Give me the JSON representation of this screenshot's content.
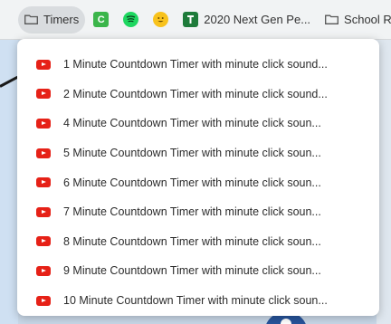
{
  "bookmarks_bar": {
    "items": [
      {
        "type": "folder",
        "label": "Timers",
        "active": true
      },
      {
        "type": "favicon",
        "icon": "classroom-c-icon",
        "label": "C"
      },
      {
        "type": "favicon",
        "icon": "spotify-icon",
        "label": ""
      },
      {
        "type": "favicon",
        "icon": "smiley-emoji-icon",
        "label": ""
      },
      {
        "type": "bookmark",
        "icon": "green-t-icon",
        "label": "2020 Next Gen Pe..."
      },
      {
        "type": "folder",
        "label": "School Re"
      }
    ]
  },
  "dropdown": {
    "items": [
      {
        "label": "1 Minute Countdown Timer with minute click sound..."
      },
      {
        "label": "2 Minute Countdown Timer with minute click sound..."
      },
      {
        "label": "4 Minute Countdown Timer with minute click soun..."
      },
      {
        "label": "5 Minute Countdown Timer with minute click soun..."
      },
      {
        "label": "6 Minute Countdown Timer with minute click soun..."
      },
      {
        "label": "7 Minute Countdown Timer with minute click soun..."
      },
      {
        "label": "8 Minute Countdown Timer with minute click soun..."
      },
      {
        "label": "9 Minute Countdown Timer with minute click soun..."
      },
      {
        "label": "10 Minute Countdown Timer with minute click soun..."
      }
    ]
  },
  "colors": {
    "youtube_red": "#e62117",
    "bar_bg": "#f1f3f4",
    "active_folder_bg": "#d9dcdf"
  }
}
